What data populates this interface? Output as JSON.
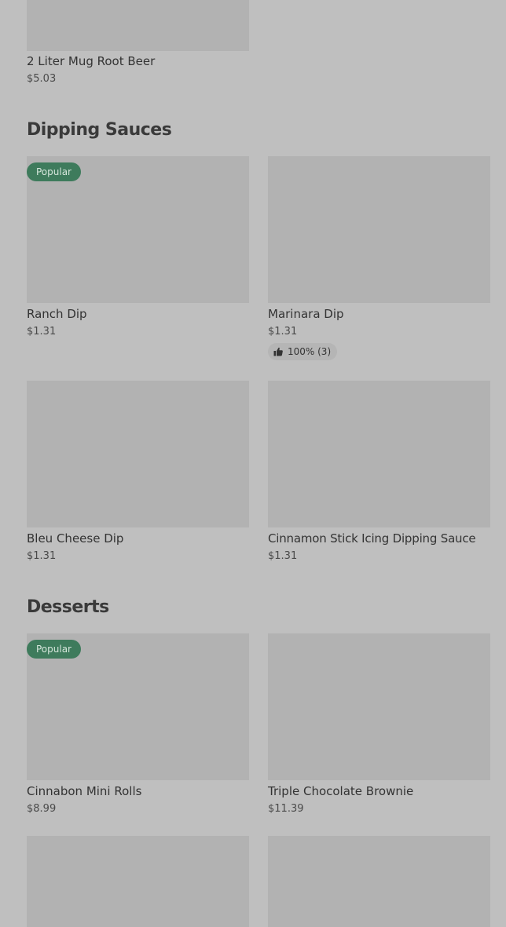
{
  "colors": {
    "page_background": "#bfbfbf",
    "image_placeholder": "#b2b2b2",
    "popular_badge_bg": "#3e7b5c",
    "popular_badge_text": "#d6e6dc",
    "text_primary": "#333333"
  },
  "top_item": {
    "name": "2 Liter Mug Root Beer",
    "price": "$5.03"
  },
  "sections": [
    {
      "title": "Dipping Sauces",
      "items": [
        {
          "name": "Ranch Dip",
          "price": "$1.31",
          "badge": "Popular"
        },
        {
          "name": "Marinara Dip",
          "price": "$1.31",
          "rating": "100% (3)",
          "rating_icon": "thumbs-up-icon"
        },
        {
          "name": "Bleu Cheese Dip",
          "price": "$1.31"
        },
        {
          "name": "Cinnamon Stick Icing Dipping Sauce",
          "price": "$1.31"
        }
      ]
    },
    {
      "title": "Desserts",
      "items": [
        {
          "name": "Cinnabon Mini Rolls",
          "price": "$8.99",
          "badge": "Popular"
        },
        {
          "name": "Triple Chocolate Brownie",
          "price": "$11.39"
        }
      ]
    }
  ]
}
